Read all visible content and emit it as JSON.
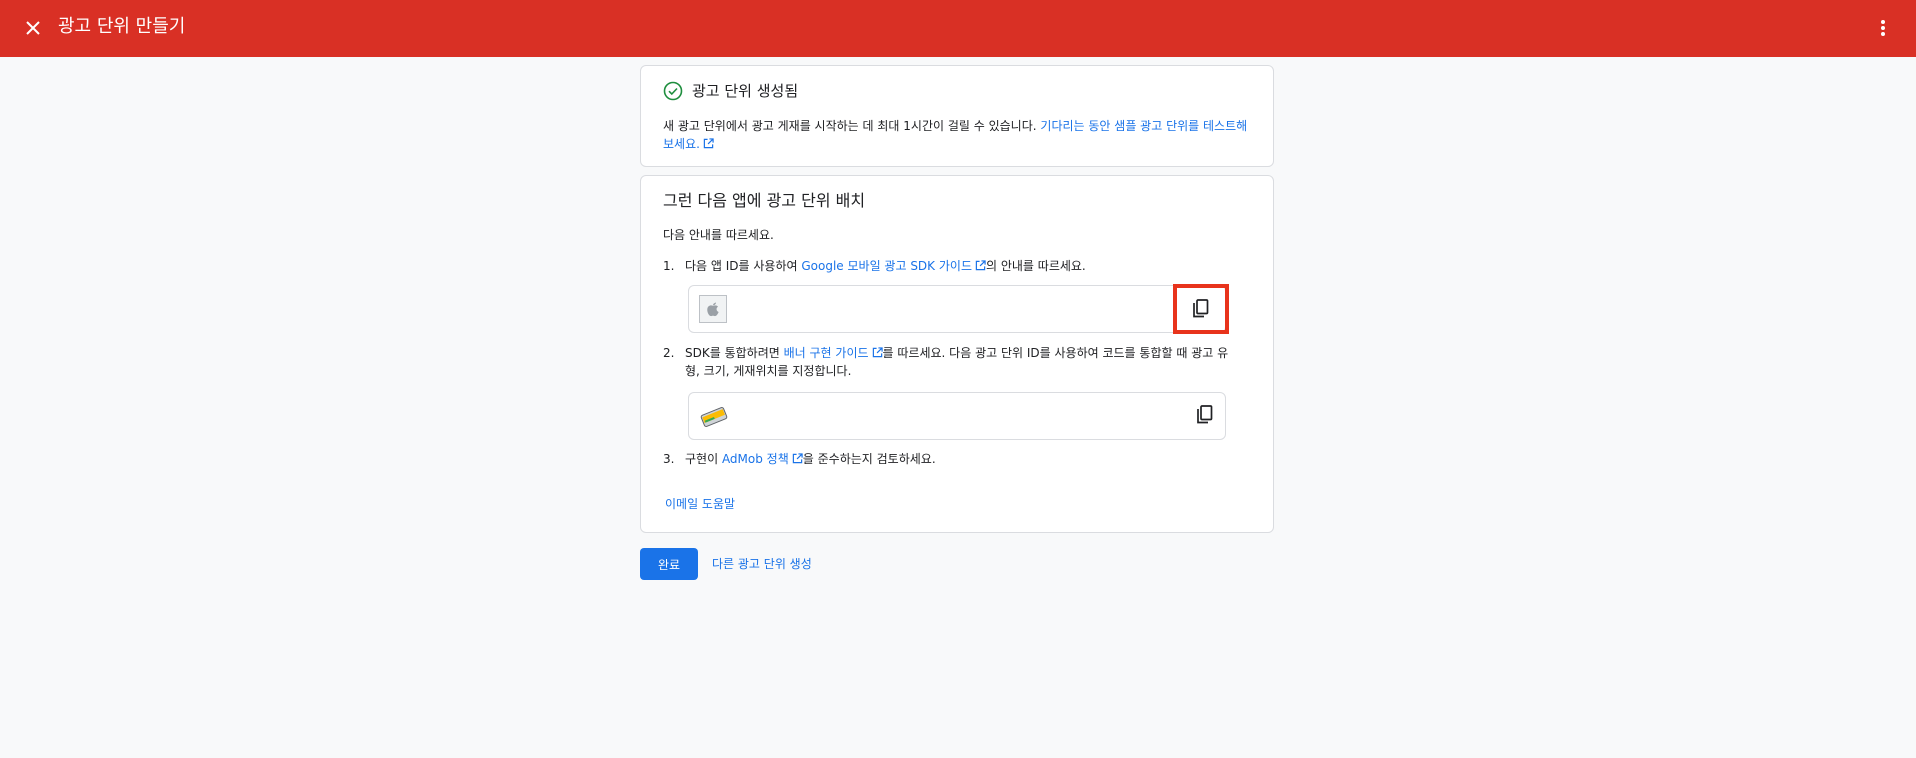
{
  "header": {
    "title": "광고 단위 만들기",
    "close_icon": "close-icon",
    "more_icon": "more-vert-icon",
    "bg_color": "#d93025"
  },
  "created_card": {
    "title": "광고 단위 생성됨",
    "status_icon": "check-circle-icon",
    "text": "새 광고 단위에서 광고 게재를 시작하는 데 최대 1시간이 걸릴 수 있습니다.",
    "link_text": "기다리는 동안 샘플 광고 단위를 테스트해 보세요."
  },
  "placement_card": {
    "title": "그런 다음 앱에 광고 단위 배치",
    "intro": "다음 안내를 따르세요.",
    "steps": [
      {
        "num": "1.",
        "pre": "다음 앱 ID를 사용하여 ",
        "link": "Google 모바일 광고 SDK 가이드",
        "post": "의 안내를 따르세요."
      },
      {
        "num": "2.",
        "pre": "SDK를 통합하려면 ",
        "link": "배너 구현 가이드",
        "post": "를 따르세요. 다음 광고 단위 ID를 사용하여 코드를 통합할 때 광고 유형, 크기, 게재위치를 지정합니다."
      },
      {
        "num": "3.",
        "pre": "구현이 ",
        "link": "AdMob 정책",
        "post": "을 준수하는지 검토하세요."
      }
    ],
    "app_id_box": {
      "icon": "apple-icon",
      "value": ""
    },
    "ad_unit_box": {
      "icon": "banner-ad-icon",
      "value": ""
    },
    "email_help": "이메일 도움말"
  },
  "actions": {
    "done": "완료",
    "create_another": "다른 광고 단위 생성"
  },
  "colors": {
    "accent": "#1a73e8",
    "success": "#1e8e3e",
    "highlight": "#e8331c"
  }
}
